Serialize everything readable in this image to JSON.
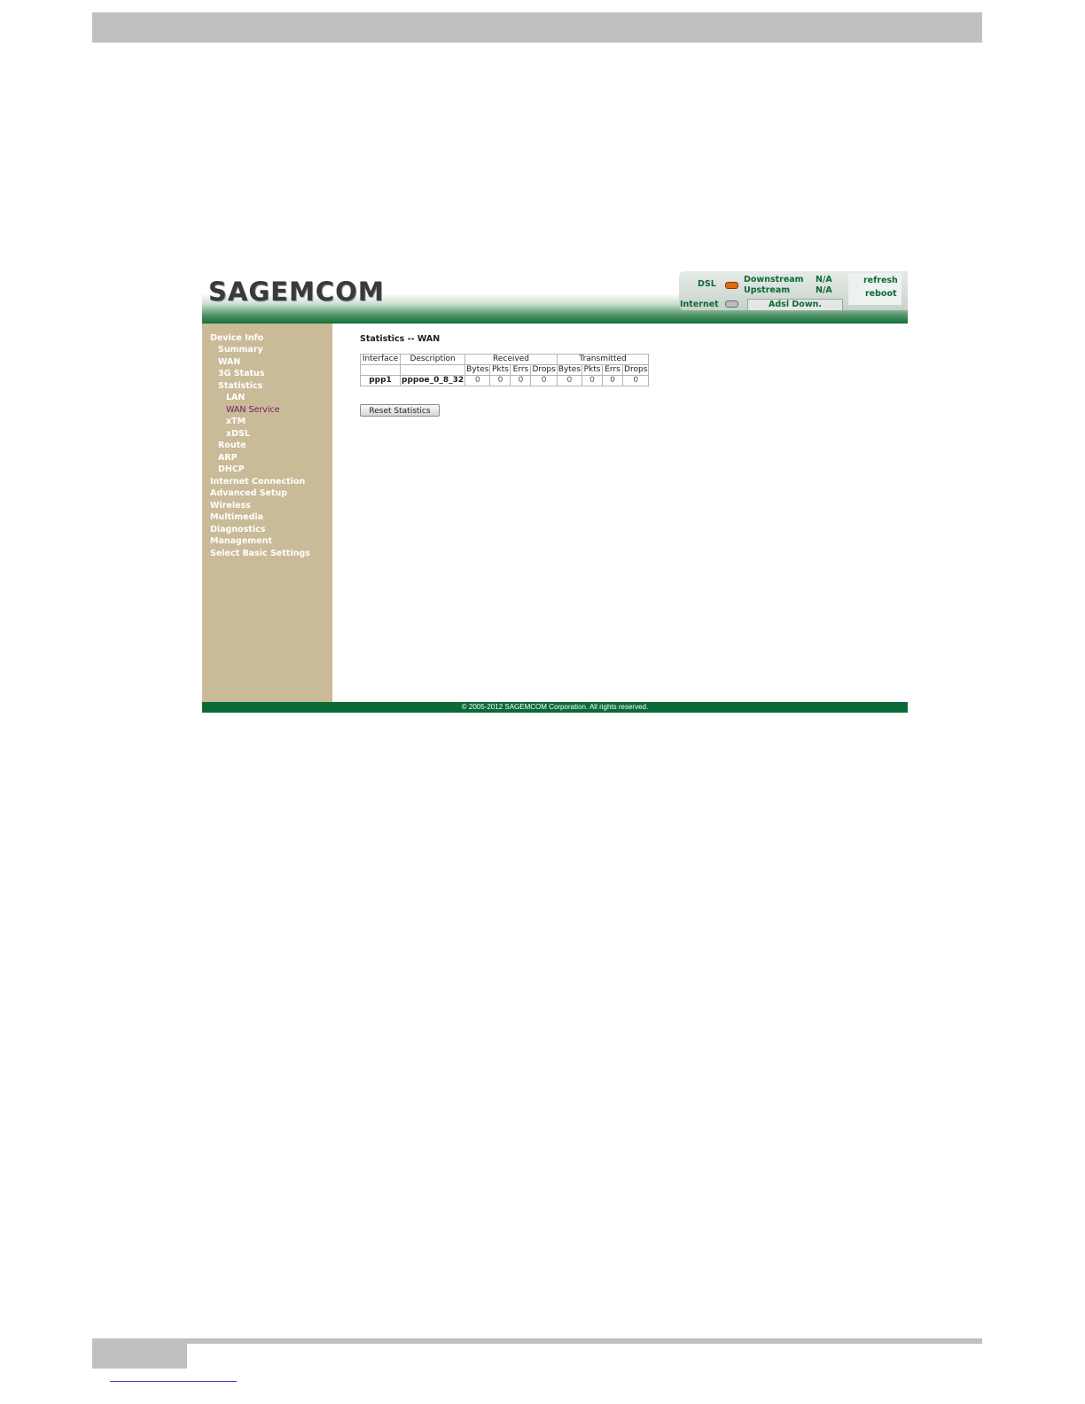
{
  "header": {
    "logo": "SAGEMCOM",
    "dsl_label": "DSL",
    "downstream_label": "Downstream",
    "downstream_value": "N/A",
    "upstream_label": "Upstream",
    "upstream_value": "N/A",
    "internet_label": "Internet",
    "adsl_status": "Adsl Down.",
    "refresh_label": "refresh",
    "reboot_label": "reboot"
  },
  "sidebar": {
    "items": [
      {
        "label": "Device Info"
      },
      {
        "label": "Summary"
      },
      {
        "label": "WAN"
      },
      {
        "label": "3G Status"
      },
      {
        "label": "Statistics"
      },
      {
        "label": "LAN"
      },
      {
        "label": "WAN Service",
        "active": true
      },
      {
        "label": "xTM"
      },
      {
        "label": "xDSL"
      },
      {
        "label": "Route"
      },
      {
        "label": "ARP"
      },
      {
        "label": "DHCP"
      },
      {
        "label": "Internet Connection"
      },
      {
        "label": "Advanced Setup"
      },
      {
        "label": "Wireless"
      },
      {
        "label": "Multimedia"
      },
      {
        "label": "Diagnostics"
      },
      {
        "label": "Management"
      },
      {
        "label": "Select Basic Settings"
      }
    ]
  },
  "content": {
    "title": "Statistics -- WAN",
    "table": {
      "col_interface": "Interface",
      "col_description": "Description",
      "group_received": "Received",
      "group_transmitted": "Transmitted",
      "subcols": [
        "Bytes",
        "Pkts",
        "Errs",
        "Drops",
        "Bytes",
        "Pkts",
        "Errs",
        "Drops"
      ],
      "rows": [
        {
          "interface": "ppp1",
          "description": "pppoe_0_8_32",
          "values": [
            "0",
            "0",
            "0",
            "0",
            "0",
            "0",
            "0",
            "0"
          ]
        }
      ]
    },
    "reset_button": "Reset Statistics"
  },
  "footer": {
    "copyright": "© 2005-2012 SAGEMCOM Corporation. All rights reserved."
  },
  "colors": {
    "brand_green": "#0a6a38",
    "sidebar_bg": "#c9bb97",
    "active_item": "#7a1568",
    "dsl_led": "#e06a10"
  }
}
